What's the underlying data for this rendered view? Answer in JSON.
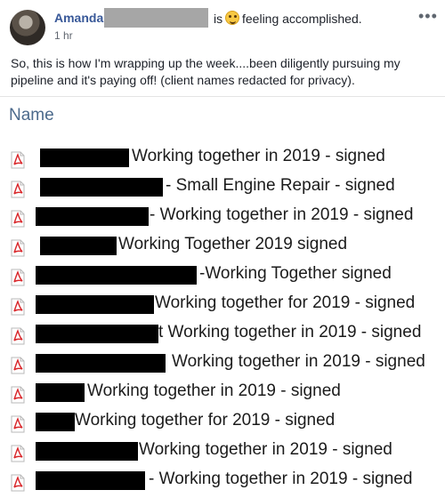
{
  "post": {
    "author": "Amanda",
    "is_label": "is",
    "feeling": "feeling accomplished.",
    "time": "1 hr",
    "more_label": "•••",
    "text": "So, this is how I'm wrapping up the week....been diligently pursuing my pipeline and it's paying off! (client names redacted for privacy)."
  },
  "file_list": {
    "column_header": "Name",
    "files": [
      {
        "name": "Working together in 2019 - signed"
      },
      {
        "name": "- Small Engine Repair - signed"
      },
      {
        "name": "- Working together in 2019 - signed"
      },
      {
        "name": "Working Together 2019 signed"
      },
      {
        "name": "-Working Together signed"
      },
      {
        "name": "Working together for 2019 - signed"
      },
      {
        "name": "t Working together in 2019 - signed"
      },
      {
        "name": "Working together in 2019 - signed"
      },
      {
        "name": "Working together in 2019 - signed"
      },
      {
        "name": "Working together for 2019 - signed"
      },
      {
        "name": "Working together in 2019 - signed"
      },
      {
        "name": "- Working together in 2019 - signed"
      }
    ]
  },
  "colors": {
    "link": "#385898",
    "pdf_red": "#d9262a",
    "redaction": "#000000"
  },
  "icons": {
    "file_type": "pdf-icon",
    "menu": "more-options-icon",
    "feeling": "emoji-icon"
  }
}
